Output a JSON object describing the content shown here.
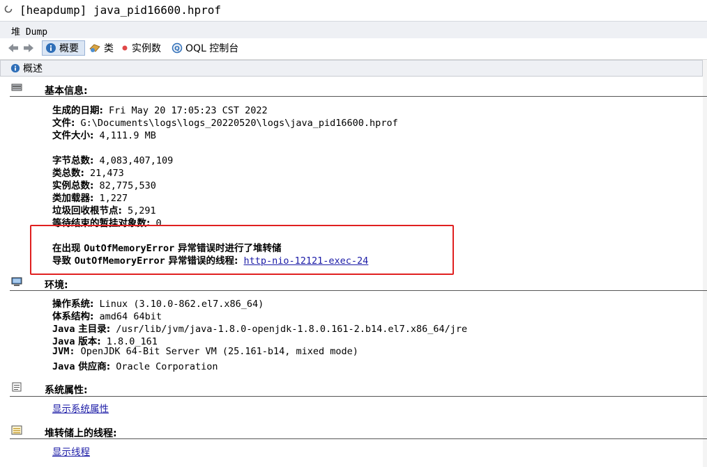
{
  "window": {
    "title": "[heapdump] java_pid16600.hprof"
  },
  "tab": {
    "label": "堆 Dump"
  },
  "toolbar": {
    "summary": "概要",
    "classes": "类",
    "instances": "实例数",
    "oql": "OQL 控制台"
  },
  "section": {
    "title": "概述"
  },
  "basic": {
    "title": "基本信息:",
    "date_label": "生成的日期:",
    "date_value": "Fri May 20 17:05:23 CST 2022",
    "file_label": "文件:",
    "file_value": "G:\\Documents\\logs\\logs_20220520\\logs\\java_pid16600.hprof",
    "size_label": "文件大小:",
    "size_value": "4,111.9 MB",
    "bytes_label": "字节总数:",
    "bytes_value": "4,083,407,109",
    "classes_label": "类总数:",
    "classes_value": "21,473",
    "instances_label": "实例总数:",
    "instances_value": "82,775,530",
    "loaders_label": "类加载器:",
    "loaders_value": "1,227",
    "gcroots_label": "垃圾回收根节点:",
    "gcroots_value": "5,291",
    "finalize_label": "等待结束的暂挂对象数:",
    "finalize_value": "0",
    "oom_line1_a": "在出现 ",
    "oom_line1_b": "OutOfMemoryError",
    "oom_line1_c": " 异常错误时进行了堆转储",
    "oom_line2_a": "导致 ",
    "oom_line2_b": "OutOfMemoryError",
    "oom_line2_c": " 异常错误的线程:",
    "oom_thread": "http-nio-12121-exec-24"
  },
  "env": {
    "title": "环境:",
    "os_label": "操作系统:",
    "os_value": "Linux (3.10.0-862.el7.x86_64)",
    "arch_label": "体系结构:",
    "arch_value": "amd64 64bit",
    "home_label_a": "Java",
    "home_label_b": " 主目录:",
    "home_value": "/usr/lib/jvm/java-1.8.0-openjdk-1.8.0.161-2.b14.el7.x86_64/jre",
    "version_label_a": "Java",
    "version_label_b": " 版本:",
    "version_value": "1.8.0_161",
    "jvm_label": "JVM:",
    "jvm_value": "OpenJDK 64-Bit Server VM (25.161-b14, mixed mode)",
    "vendor_label_a": "Java",
    "vendor_label_b": " 供应商:",
    "vendor_value": "Oracle Corporation"
  },
  "sysprops": {
    "title": "系统属性:",
    "link": "显示系统属性"
  },
  "threads": {
    "title": "堆转储上的线程:",
    "link": "显示线程"
  }
}
